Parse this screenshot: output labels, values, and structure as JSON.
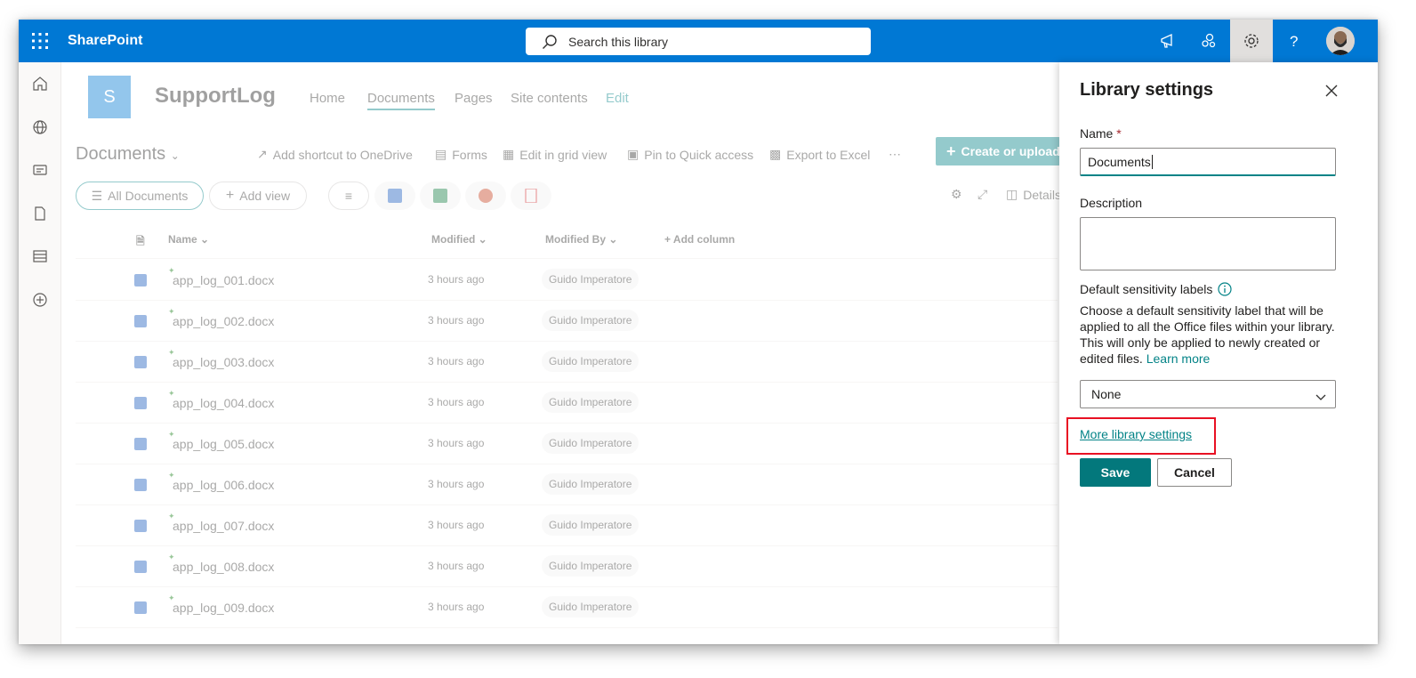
{
  "topbar": {
    "brand": "SharePoint",
    "search_placeholder": "Search this library",
    "accent_color": "#0078d4"
  },
  "site": {
    "logo_letter": "S",
    "name": "SupportLog",
    "nav": [
      "Home",
      "Documents",
      "Pages",
      "Site contents",
      "Edit"
    ]
  },
  "library": {
    "title": "Documents",
    "commands": [
      "Add shortcut to OneDrive",
      "Forms",
      "Edit in grid view",
      "Pin to Quick access",
      "Export to Excel"
    ],
    "create_label": "Create or upload",
    "view_label": "All Documents",
    "add_view_label": "Add view",
    "details_label": "Details",
    "columns": {
      "name": "Name",
      "modified": "Modified",
      "modified_by": "Modified By",
      "add_column": "Add column"
    },
    "files": [
      {
        "name": "app_log_001.docx",
        "modified": "3 hours ago",
        "by": "Guido Imperatore"
      },
      {
        "name": "app_log_002.docx",
        "modified": "3 hours ago",
        "by": "Guido Imperatore"
      },
      {
        "name": "app_log_003.docx",
        "modified": "3 hours ago",
        "by": "Guido Imperatore"
      },
      {
        "name": "app_log_004.docx",
        "modified": "3 hours ago",
        "by": "Guido Imperatore"
      },
      {
        "name": "app_log_005.docx",
        "modified": "3 hours ago",
        "by": "Guido Imperatore"
      },
      {
        "name": "app_log_006.docx",
        "modified": "3 hours ago",
        "by": "Guido Imperatore"
      },
      {
        "name": "app_log_007.docx",
        "modified": "3 hours ago",
        "by": "Guido Imperatore"
      },
      {
        "name": "app_log_008.docx",
        "modified": "3 hours ago",
        "by": "Guido Imperatore"
      },
      {
        "name": "app_log_009.docx",
        "modified": "3 hours ago",
        "by": "Guido Imperatore"
      }
    ]
  },
  "panel": {
    "title": "Library settings",
    "name_label": "Name",
    "required_mark": "*",
    "name_value": "Documents",
    "description_label": "Description",
    "description_value": "",
    "sensitivity_label": "Default sensitivity labels",
    "sensitivity_text": "Choose a default sensitivity label that will be applied to all the Office files within your library. This will only be applied to newly created or edited files.",
    "learn_more": "Learn more",
    "dropdown_value": "None",
    "more_settings_link": "More library settings",
    "save_label": "Save",
    "cancel_label": "Cancel",
    "accent_color": "#038387",
    "highlight_color": "#e81123"
  }
}
